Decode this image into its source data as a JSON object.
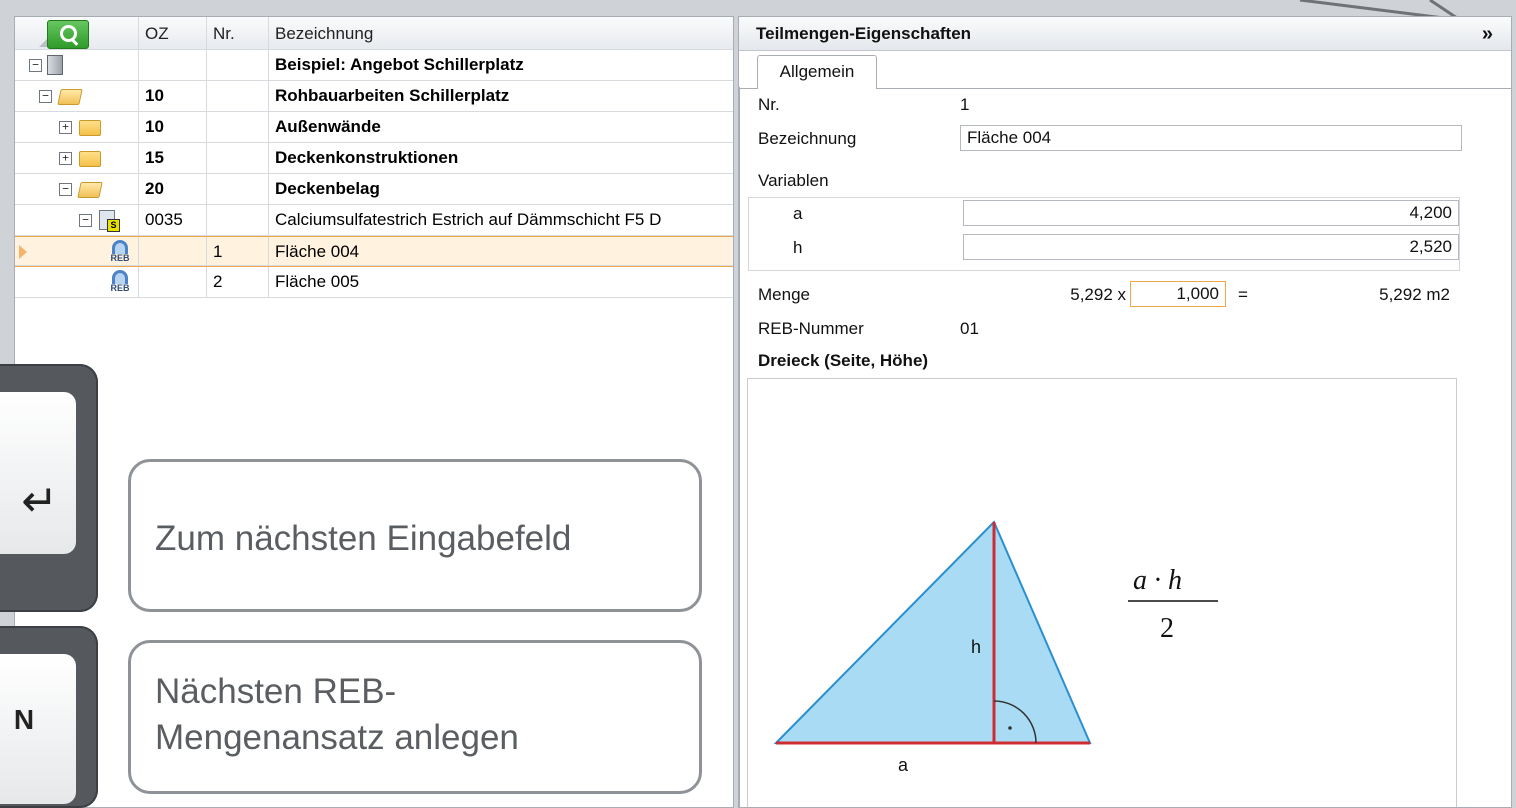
{
  "grid": {
    "headers": [
      "",
      "OZ",
      "Nr.",
      "Bezeichnung"
    ],
    "rows": [
      {
        "oz": "",
        "nr": "",
        "bez": "Beispiel: Angebot Schillerplatz",
        "bold": true
      },
      {
        "oz": "10",
        "nr": "",
        "bez": "Rohbauarbeiten Schillerplatz",
        "bold": true
      },
      {
        "oz": "10",
        "nr": "",
        "bez": "Außenwände",
        "bold": true
      },
      {
        "oz": "15",
        "nr": "",
        "bez": "Deckenkonstruktionen",
        "bold": true
      },
      {
        "oz": "20",
        "nr": "",
        "bez": "Deckenbelag",
        "bold": true
      },
      {
        "oz": "0035",
        "nr": "",
        "bez": "Calciumsulfatestrich Estrich auf Dämmschicht F5 D",
        "bold": false
      },
      {
        "oz": "",
        "nr": "1",
        "bez": "Fläche 004",
        "bold": false
      },
      {
        "oz": "",
        "nr": "2",
        "bez": "Fläche 005",
        "bold": false
      }
    ],
    "toggle_minus": "−",
    "toggle_plus": "+",
    "reb_label": "REB",
    "position_badge": "S"
  },
  "overlay": {
    "key_enter": "↵",
    "key_n": "N",
    "callout_enter": "Zum nächsten Eingabefeld",
    "callout_n_line1": "Nächsten REB-",
    "callout_n_line2": "Mengenansatz anlegen"
  },
  "properties": {
    "title": "Teilmengen-Eigenschaften",
    "collapse_label": "»",
    "tab_general": "Allgemein",
    "nr_label": "Nr.",
    "nr_value": "1",
    "bez_label": "Bezeichnung",
    "bez_value": "Fläche 004",
    "variables_label": "Variablen",
    "var_a_name": "a",
    "var_a_value": "4,200",
    "var_h_name": "h",
    "var_h_value": "2,520",
    "menge_label": "Menge",
    "menge_base": "5,292 x",
    "menge_factor": "1,000",
    "menge_eq": "=",
    "menge_result": "5,292 m2",
    "reb_label": "REB-Nummer",
    "reb_value": "01",
    "formula_title": "Dreieck (Seite, Höhe)",
    "figure_label_h": "h",
    "figure_label_a": "a",
    "formula_numerator": "a · h",
    "formula_denominator": "2"
  }
}
